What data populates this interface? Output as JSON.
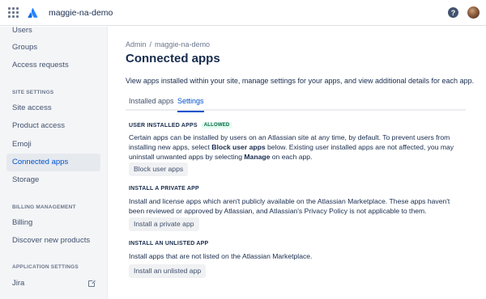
{
  "header": {
    "site_name": "maggie-na-demo",
    "help_label": "?"
  },
  "sidebar": {
    "items_top": [
      {
        "label": "Users"
      },
      {
        "label": "Groups"
      },
      {
        "label": "Access requests"
      }
    ],
    "site_settings_heading": "SITE SETTINGS",
    "site_settings_items": [
      {
        "label": "Site access"
      },
      {
        "label": "Product access"
      },
      {
        "label": "Emoji"
      },
      {
        "label": "Connected apps",
        "active": true
      },
      {
        "label": "Storage"
      }
    ],
    "billing_heading": "BILLING MANAGEMENT",
    "billing_items": [
      {
        "label": "Billing"
      },
      {
        "label": "Discover new products"
      }
    ],
    "app_settings_heading": "APPLICATION SETTINGS",
    "app_settings_items": [
      {
        "label": "Jira",
        "icon": "external-link-icon"
      }
    ]
  },
  "main": {
    "breadcrumb": {
      "root": "Admin",
      "separator": "/",
      "current": "maggie-na-demo"
    },
    "title": "Connected apps",
    "intro": "View apps installed within your site, manage settings for your apps, and view additional details for each app.",
    "tabs": [
      {
        "label": "Installed apps"
      },
      {
        "label": "Settings",
        "active": true
      }
    ],
    "sections": {
      "user_installed": {
        "title": "USER INSTALLED APPS",
        "badge": "ALLOWED",
        "text_1": "Certain apps can be installed by users on an Atlassian site at any time, by default. To prevent users from installing new apps, select ",
        "bold_1": "Block user apps",
        "text_2": " below. Existing user installed apps are not affected, you may uninstall unwanted apps by selecting ",
        "bold_2": "Manage",
        "text_3": " on each app.",
        "button": "Block user apps"
      },
      "private_app": {
        "title": "INSTALL A PRIVATE APP",
        "text": "Install and license apps which aren't publicly available on the Atlassian Marketplace. These apps haven't been reviewed or approved by Atlassian, and Atlassian's Privacy Policy is not applicable to them.",
        "button": "Install a private app"
      },
      "unlisted_app": {
        "title": "INSTALL AN UNLISTED APP",
        "text": "Install apps that are not listed on the Atlassian Marketplace.",
        "button": "Install an unlisted app"
      }
    }
  },
  "colors": {
    "accent": "#0052cc",
    "sidebar_bg": "#f4f5f7",
    "badge_bg": "#e3fcef",
    "badge_text": "#006644"
  }
}
